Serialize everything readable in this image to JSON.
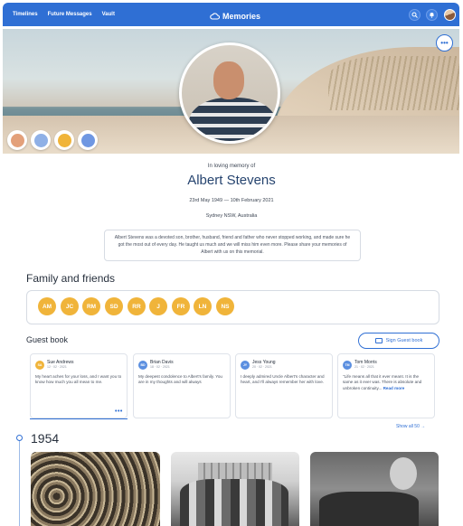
{
  "nav": {
    "links": [
      "Timelines",
      "Future Messages",
      "Vault"
    ],
    "logo_text": "Memories",
    "icons": [
      "search-icon",
      "bell-icon",
      "user-avatar"
    ]
  },
  "hero": {
    "badges": [
      "calendar-badge-icon",
      "shirt-badge-icon",
      "car-badge-icon",
      "building-badge-icon"
    ],
    "more_label": "•••"
  },
  "memorial": {
    "in_memory": "In loving memory of",
    "name": "Albert Stevens",
    "dates": "23rd May 1949  —  10th February 2021",
    "place": "Sydney NSW, Australia",
    "bio": "Albert Stevens was a devoted son, brother, husband, friend and father who never stopped working, and made sure he got the most out of every day. He taught us much and we will miss him even more. Please share your memories of Albert with us on this memorial."
  },
  "family": {
    "title": "Family and friends",
    "members": [
      "AM",
      "JC",
      "RM",
      "SD",
      "RR",
      "J",
      "FR",
      "LN",
      "NS"
    ]
  },
  "guestbook": {
    "title": "Guest book",
    "sign_label": "Sign Guest book",
    "show_all": "Show all 50",
    "entries": [
      {
        "initials": "SA",
        "name": "Sue Andrews",
        "date": "12 · 02 · 2021",
        "text": "My heart aches for your loss, and I want you to know how much you all mean to me.",
        "more": "",
        "color": "#f0b43a"
      },
      {
        "initials": "BD",
        "name": "Brian Davis",
        "date": "18 · 02 · 2021",
        "text": "My deepest condolence to Albert's family. You are in my thoughts and will always",
        "more": "",
        "color": "#5b8fe0"
      },
      {
        "initials": "JY",
        "name": "Jess Young",
        "date": "20 · 02 · 2021",
        "text": "I deeply admired Uncle Albert's character and heart, and I'll always remember her with love.",
        "more": "",
        "color": "#5b8fe0"
      },
      {
        "initials": "TM",
        "name": "Tom Morris",
        "date": "21 · 02 · 2021",
        "text": "\"Life means all that it ever meant. It is the same as it ever was. There is absolute and unbroken continuity...",
        "more": "Read more",
        "color": "#5b8fe0"
      }
    ],
    "dots": "•••"
  },
  "timeline": {
    "year": "1954"
  }
}
